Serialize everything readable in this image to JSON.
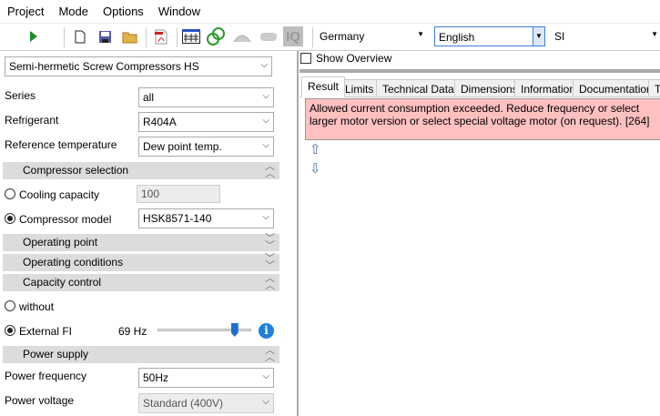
{
  "menu": [
    "Project",
    "Mode",
    "Options",
    "Window"
  ],
  "toolbar": {
    "country": "Germany",
    "language": "English",
    "units": "SI"
  },
  "left": {
    "product": "Semi-hermetic Screw Compressors HS",
    "series_label": "Series",
    "series": "all",
    "refrigerant_label": "Refrigerant",
    "refrigerant": "R404A",
    "reftemp_label": "Reference temperature",
    "reftemp": "Dew point temp.",
    "sec_compressor": "Compressor selection",
    "cooling_label": "Cooling capacity",
    "cooling_value": "100",
    "model_label": "Compressor model",
    "model": "HSK8571-140",
    "sec_opoint": "Operating point",
    "sec_opcond": "Operating conditions",
    "sec_capacity": "Capacity control",
    "without_label": "without",
    "extfi_label": "External FI",
    "extfi_value": "69 Hz",
    "slider_fraction": 0.85,
    "sec_power": "Power supply",
    "freq_label": "Power frequency",
    "freq": "50Hz",
    "voltage_label": "Power voltage",
    "voltage": "Standard (400V)"
  },
  "right": {
    "show_overview": "Show Overview",
    "tabs": [
      "Result",
      "Limits",
      "Technical Data",
      "Dimensions",
      "Information",
      "Documentation",
      "T"
    ],
    "message": "Allowed current consumption exceeded. Reduce frequency or select larger motor version or select special voltage motor (on request). [264]"
  }
}
